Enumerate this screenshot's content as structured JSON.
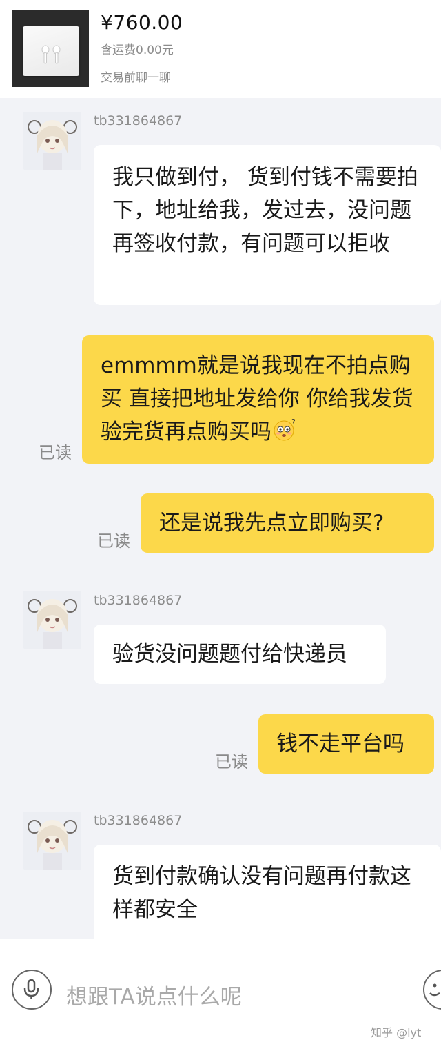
{
  "product": {
    "price": "¥760.00",
    "shipping": "含运费0.00元",
    "chat_note": "交易前聊一聊"
  },
  "messages": [
    {
      "sender": "tb331864867",
      "direction": "incoming",
      "text": "我只做到付， 货到付钱不需要拍下，地址给我，发过去，没问题再签收付款，有问题可以拒收"
    },
    {
      "direction": "outgoing",
      "status": "已读",
      "text": "emmmm就是说我现在不拍点购买 直接把地址发给你 你给我发货 验完货再点购买吗",
      "emoji": "flushed-face-icon"
    },
    {
      "direction": "outgoing",
      "status": "已读",
      "text": "还是说我先点立即购买?"
    },
    {
      "sender": "tb331864867",
      "direction": "incoming",
      "text": "验货没问题题付给快递员"
    },
    {
      "direction": "outgoing",
      "status": "已读",
      "text": "钱不走平台吗"
    },
    {
      "sender": "tb331864867",
      "direction": "incoming",
      "text": "货到付款确认没有问题再付款这样都安全"
    }
  ],
  "input": {
    "placeholder": "想跟TA说点什么呢",
    "voice_icon": "microphone-icon",
    "emoji_icon": "smiley-icon"
  },
  "watermark": "知乎 @lyt",
  "colors": {
    "background": "#f2f3f7",
    "outgoing_bubble": "#fcd84a",
    "incoming_bubble": "#ffffff",
    "muted_text": "#8c8c8c"
  }
}
